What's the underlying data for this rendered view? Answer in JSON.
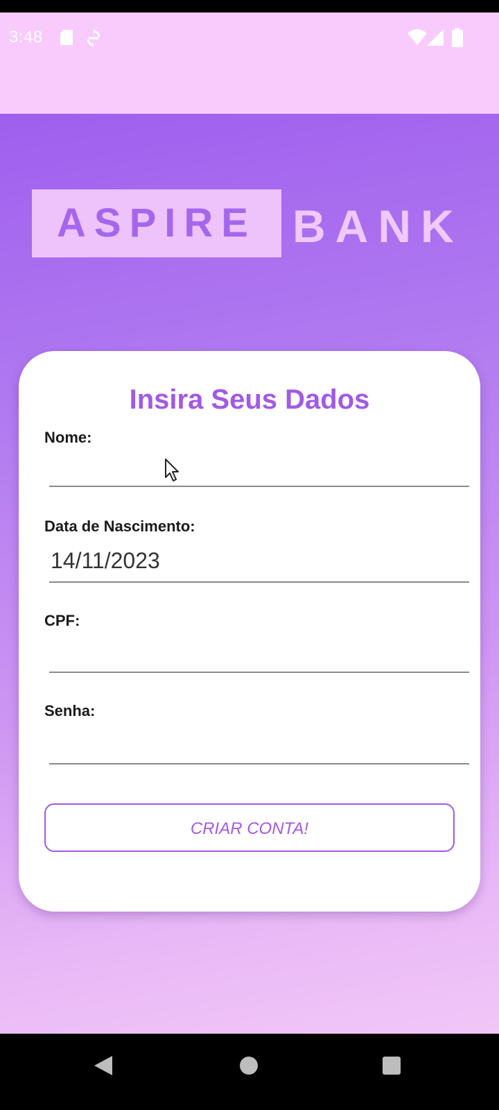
{
  "status_bar": {
    "time": "3:48",
    "icons": [
      "sd-card-icon",
      "sync-icon",
      "wifi-icon",
      "signal-icon",
      "battery-icon"
    ]
  },
  "logo": {
    "word1": "ASPIRE",
    "word2": "BANK"
  },
  "form": {
    "title": "Insira Seus Dados",
    "fields": [
      {
        "label": "Nome:",
        "value": "",
        "placeholder": ""
      },
      {
        "label": "Data de Nascimento:",
        "value": "14/11/2023",
        "placeholder": ""
      },
      {
        "label": "CPF:",
        "value": "",
        "placeholder": ""
      },
      {
        "label": "Senha:",
        "value": "",
        "placeholder": ""
      }
    ],
    "submit_label": "CRIAR CONTA!"
  },
  "nav": {
    "icons": [
      "back-icon",
      "home-icon",
      "recents-icon"
    ]
  },
  "colors": {
    "accent": "#a259e6",
    "status_bar_bg": "#f9cbfd",
    "gradient_top": "#9f5fee",
    "gradient_bottom": "#f2c6f8",
    "card_bg": "#ffffff"
  }
}
